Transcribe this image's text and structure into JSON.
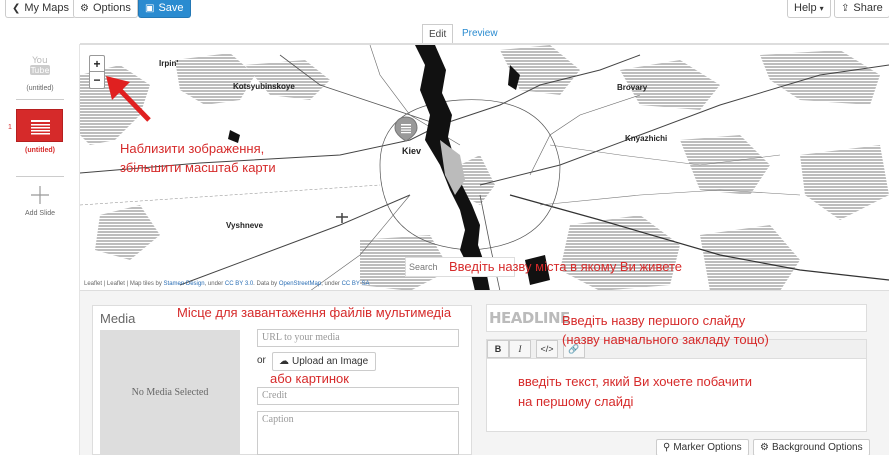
{
  "topbar": {
    "my_maps": "My Maps",
    "options": "Options",
    "save": "Save",
    "help": "Help",
    "share": "Share"
  },
  "mode_tabs": {
    "edit": "Edit",
    "preview": "Preview"
  },
  "slides": {
    "title_slide_label": "(untitled)",
    "slide1_number": "1",
    "slide1_label": "(untitled)",
    "add_slide": "Add Slide"
  },
  "map": {
    "cities": {
      "irpin": "Irpin'",
      "kotsyubinskoye": "Kotsyubinskoye",
      "brovary": "Brovary",
      "kiev": "Kiev",
      "knyazhichi": "Knyazhichi",
      "vyshneve": "Vyshneve"
    },
    "zoom_in": "+",
    "zoom_out": "−",
    "search_placeholder": "Search",
    "attribution_leaflet1": "Leaflet",
    "attribution_leaflet2": "Leaflet",
    "attribution_text1": "| Map tiles by",
    "attribution_stamen": "Stamen Design",
    "attribution_text2": ", under",
    "attribution_ccby30": "CC BY 3.0",
    "attribution_text3": ". Data by",
    "attribution_osm": "OpenStreetMap",
    "attribution_text4": ", under",
    "attribution_ccbysa": "CC BY SA"
  },
  "annotations": {
    "zoom_line1": "Наблизити зображення,",
    "zoom_line2": "збільшити масштаб карти",
    "search_hint": "Введіть назву міста в якому Ви живете",
    "media_hint": "Місце для завантаження файлів мультимедіа",
    "headline_line1": "Введіть назву першого слайду",
    "headline_line2": "(назву навчального закладу тощо)",
    "image_hint": "або картинок",
    "text_line1": "введіть текст, який Ви хочете побачити",
    "text_line2": "на першому слайді"
  },
  "media": {
    "title": "Media",
    "no_media": "No Media Selected",
    "url_placeholder": "URL to your media",
    "or": "or",
    "upload": "Upload an Image",
    "credit_placeholder": "Credit",
    "caption_placeholder": "Caption"
  },
  "text": {
    "headline_placeholder": "HEADLINE",
    "bold": "B",
    "italic": "I",
    "code": "</>"
  },
  "options": {
    "marker": "Marker Options",
    "background": "Background Options"
  },
  "colors": {
    "accent_blue": "#2a8bd0",
    "annotation_red": "#d62a2a",
    "slide_red": "#d62a2a"
  }
}
